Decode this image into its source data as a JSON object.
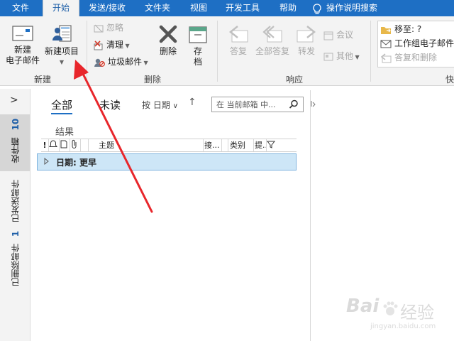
{
  "menubar": {
    "tabs": [
      "文件",
      "开始",
      "发送/接收",
      "文件夹",
      "视图",
      "开发工具",
      "帮助"
    ],
    "tell_me": "操作说明搜索"
  },
  "ribbon": {
    "new_group": {
      "label": "新建",
      "new_email_line1": "新建",
      "new_email_line2": "电子邮件",
      "new_items": "新建项目"
    },
    "delete_group": {
      "label": "删除",
      "ignore": "忽略",
      "clean": "清理",
      "junk": "垃圾邮件",
      "delete": "删除",
      "archive_line1": "存",
      "archive_line2": "档"
    },
    "respond_group": {
      "label": "响应",
      "reply": "答复",
      "reply_all": "全部答复",
      "forward": "转发",
      "meeting": "会议",
      "more": "其他"
    },
    "quick_steps": {
      "label": "快",
      "move_to": "移至: ?",
      "team_email": "工作组电子邮件",
      "reply_delete": "答复和删除"
    }
  },
  "leftnav": {
    "expand": ">",
    "inbox": "收件箱",
    "inbox_count": "10",
    "sent": "已发送邮件",
    "deleted": "已删除邮件",
    "deleted_count": "1"
  },
  "mail": {
    "filter_all": "全部",
    "filter_unread": "未读",
    "sort_by": "按 日期",
    "search_placeholder": "在 当前邮箱 中...",
    "results": "结果",
    "columns": {
      "icon_importance": "!",
      "subject": "主题",
      "received": "接...",
      "category": "类别",
      "mention": "提..."
    },
    "group_row": "日期: 更早"
  },
  "watermark": {
    "brand": "Bai",
    "brand2": "经验",
    "url": "jingyan.baidu.com"
  },
  "colors": {
    "accent": "#1e6fc4",
    "annotation_arrow": "#e8262b",
    "selection": "#cde6f7"
  }
}
